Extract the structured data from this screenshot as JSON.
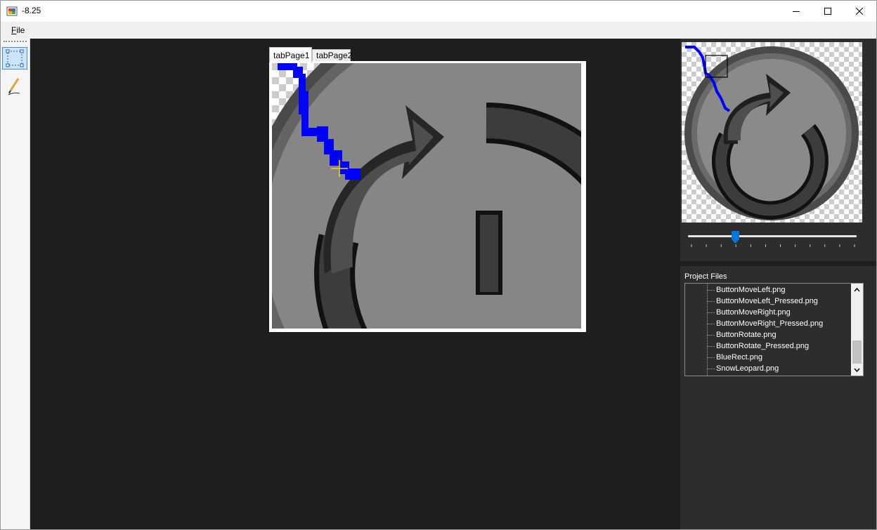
{
  "window": {
    "title": "-8.25",
    "minimize_icon": "minimize-icon",
    "maximize_icon": "maximize-icon",
    "close_icon": "close-icon"
  },
  "menu": {
    "file_first": "F",
    "file_rest": "ile"
  },
  "toolbar": {
    "tools": [
      {
        "name": "rectangle-select-tool",
        "icon": "rectangle-select-icon",
        "active": true
      },
      {
        "name": "pencil-tool",
        "icon": "pencil-icon",
        "active": false
      }
    ]
  },
  "tabs": [
    {
      "label": "tabPage1",
      "selected": true
    },
    {
      "label": "tabPage2",
      "selected": false
    }
  ],
  "zoom_slider": {
    "ticks": 12,
    "value_fraction": 0.27
  },
  "project_files": {
    "label": "Project Files",
    "items": [
      "ButtonMoveLeft.png",
      "ButtonMoveLeft_Pressed.png",
      "ButtonMoveRight.png",
      "ButtonMoveRight_Pressed.png",
      "ButtonRotate.png",
      "ButtonRotate_Pressed.png",
      "BlueRect.png",
      "SnowLeopard.png"
    ]
  },
  "colors": {
    "workspace_bg": "#1e1e1e",
    "panel_bg": "#2d2d2d",
    "stroke_blue": "#0000ff",
    "crosshair": "#ffd400",
    "accent": "#0078d7"
  }
}
